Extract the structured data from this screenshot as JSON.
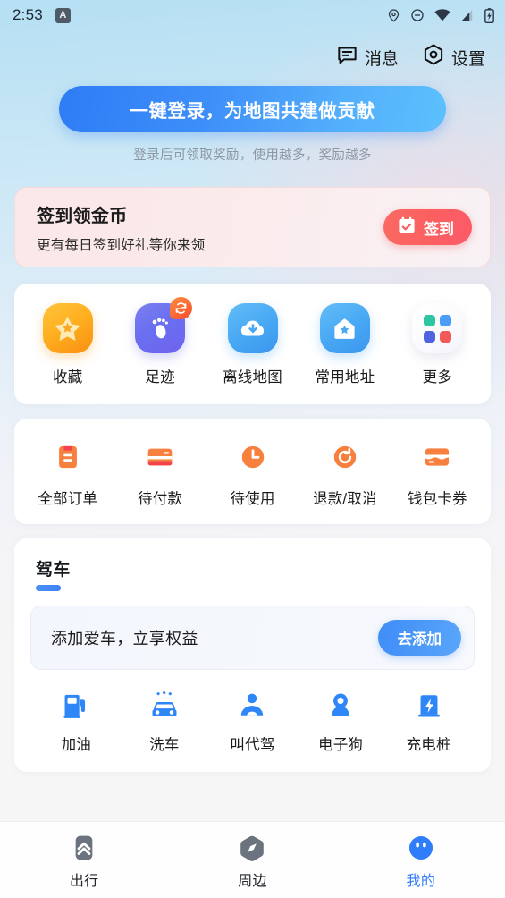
{
  "status_bar": {
    "time": "2:53",
    "app_badge_letter": "A",
    "icons": [
      "location-pin-icon",
      "do-not-disturb-icon",
      "wifi-icon",
      "cellular-signal-icon",
      "battery-charging-icon"
    ]
  },
  "header": {
    "message_label": "消息",
    "settings_label": "设置"
  },
  "login": {
    "button_label": "一键登录，为地图共建做贡献",
    "subtitle": "登录后可领取奖励，使用越多，奖励越多",
    "gradient_from": "#2f7cf6",
    "gradient_to": "#5cc0fd"
  },
  "signin": {
    "title": "签到领金币",
    "desc": "更有每日签到好礼等你来领",
    "button_label": "签到",
    "button_color": "#fb6060"
  },
  "quick_actions": [
    {
      "label": "收藏",
      "icon": "star-icon",
      "color": "#ffb020"
    },
    {
      "label": "足迹",
      "icon": "footprint-icon",
      "color": "#6a6ff0",
      "badge": "sync-icon"
    },
    {
      "label": "离线地图",
      "icon": "cloud-download-icon",
      "color": "#49a9f4"
    },
    {
      "label": "常用地址",
      "icon": "home-star-icon",
      "color": "#49a9f4"
    },
    {
      "label": "更多",
      "icon": "grid-more-icon",
      "color": "#ffffff"
    }
  ],
  "more_icon_colors": [
    "#2cc6a0",
    "#4a9cf6",
    "#4f63e0",
    "#f25a5a"
  ],
  "orders": [
    {
      "label": "全部订单",
      "icon": "order-list-icon"
    },
    {
      "label": "待付款",
      "icon": "credit-card-icon"
    },
    {
      "label": "待使用",
      "icon": "clock-icon"
    },
    {
      "label": "退款/取消",
      "icon": "refund-refresh-icon"
    },
    {
      "label": "钱包卡券",
      "icon": "wallet-icon"
    }
  ],
  "order_icon_color": "#f87c3c",
  "drive": {
    "title": "驾车",
    "promo_text": "添加爱车，立享权益",
    "promo_button_label": "去添加",
    "accent_color": "#3f82f5"
  },
  "services": [
    {
      "label": "加油",
      "icon": "gas-pump-icon"
    },
    {
      "label": "洗车",
      "icon": "car-wash-icon"
    },
    {
      "label": "叫代驾",
      "icon": "driver-person-icon"
    },
    {
      "label": "电子狗",
      "icon": "radar-detector-icon"
    },
    {
      "label": "充电桩",
      "icon": "charging-station-icon"
    }
  ],
  "service_icon_color": "#2f86f7",
  "tabbar": {
    "active_color": "#2f7dfa",
    "inactive_color": "#6b737e",
    "items": [
      {
        "label": "出行",
        "icon": "travel-chevrons-icon",
        "active": false
      },
      {
        "label": "周边",
        "icon": "nearby-compass-icon",
        "active": false
      },
      {
        "label": "我的",
        "icon": "profile-face-icon",
        "active": true
      }
    ]
  }
}
